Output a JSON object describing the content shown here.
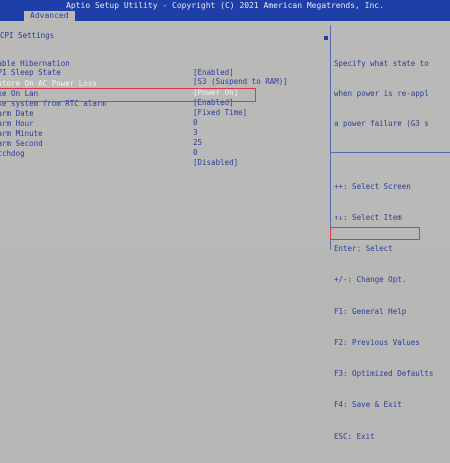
{
  "title": "Aptio Setup Utility - Copyright (C) 2021 American Megatrends, Inc.",
  "tab": "Advanced",
  "section_title": "CPI Settings",
  "settings": [
    {
      "label": "nable Hibernation",
      "value": "[Enabled]"
    },
    {
      "label": "CPI Sleep State",
      "value": "[S3 (Suspend to RAM)]"
    },
    {
      "label": "estore On AC Power Loss",
      "value": "[Power On]"
    },
    {
      "label": "ake On Lan",
      "value": "[Enabled]"
    },
    {
      "label": "ake system from RTC alarm",
      "value": "[Fixed Time]"
    },
    {
      "label": "larm Date",
      "value": "0"
    },
    {
      "label": "larm Hour",
      "value": "3"
    },
    {
      "label": "larm Minute",
      "value": "25"
    },
    {
      "label": "larm Second",
      "value": "0"
    },
    {
      "label": "atchdog",
      "value": "[Disabled]"
    }
  ],
  "help_text": {
    "line1": "Specify what state to",
    "line2": "when power is re-appl",
    "line3": "a power failure (G3 s"
  },
  "keys": [
    "++: Select Screen",
    "↑↓: Select Item",
    "Enter: Select",
    "+/-: Change Opt.",
    "F1: General Help",
    "F2: Previous Values",
    "F3: Optimized Defaults",
    "F4: Save & Exit",
    "ESC: Exit"
  ],
  "colors": {
    "blue": "#1e3ea8",
    "panel_bg": "#b9b9b7",
    "text": "#2b3d9b",
    "selected_text": "#f4f4f4",
    "highlight_red": "#d83a4a"
  }
}
